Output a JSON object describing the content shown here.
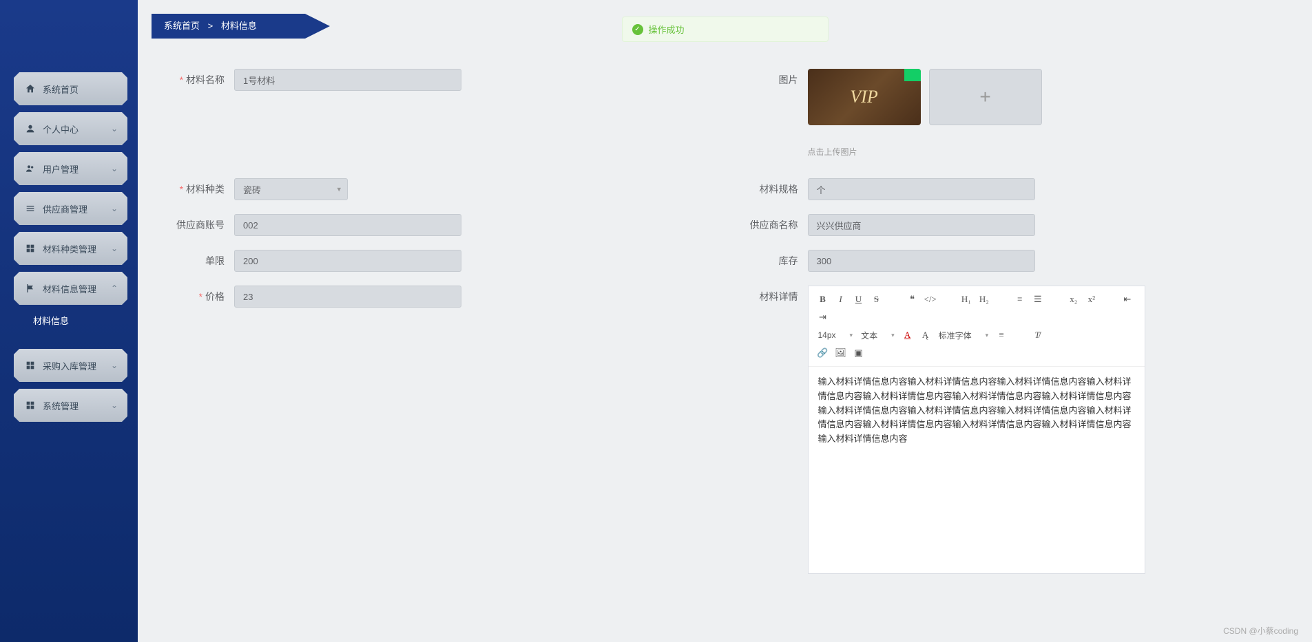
{
  "breadcrumb": {
    "home": "系统首页",
    "sep": ">",
    "current": "材料信息"
  },
  "alert": {
    "text": "操作成功"
  },
  "sidebar": {
    "items": [
      {
        "label": "系统首页",
        "icon": "home"
      },
      {
        "label": "个人中心",
        "icon": "user",
        "expandable": true
      },
      {
        "label": "用户管理",
        "icon": "users",
        "expandable": true
      },
      {
        "label": "供应商管理",
        "icon": "list",
        "expandable": true
      },
      {
        "label": "材料种类管理",
        "icon": "grid",
        "expandable": true
      },
      {
        "label": "材料信息管理",
        "icon": "flag",
        "expandable": true,
        "expanded": true
      },
      {
        "label": "材料信息",
        "active": true
      },
      {
        "label": "采购入库管理",
        "icon": "grid",
        "expandable": true
      },
      {
        "label": "系统管理",
        "icon": "grid",
        "expandable": true
      }
    ]
  },
  "form": {
    "material_name": {
      "label": "材料名称",
      "value": "1号材料"
    },
    "image": {
      "label": "图片",
      "hint": "点击上传图片",
      "thumb_text": "VIP"
    },
    "material_type": {
      "label": "材料种类",
      "value": "瓷砖"
    },
    "material_spec": {
      "label": "材料规格",
      "value": "个"
    },
    "supplier_account": {
      "label": "供应商账号",
      "value": "002"
    },
    "supplier_name": {
      "label": "供应商名称",
      "value": "兴兴供应商"
    },
    "unit_limit": {
      "label": "单限",
      "value": "200"
    },
    "stock": {
      "label": "库存",
      "value": "300"
    },
    "price": {
      "label": "价格",
      "value": "23"
    },
    "detail": {
      "label": "材料详情",
      "content": "输入材料详情信息内容输入材料详情信息内容输入材料详情信息内容输入材料详情信息内容输入材料详情信息内容输入材料详情信息内容输入材料详情信息内容输入材料详情信息内容输入材料详情信息内容输入材料详情信息内容输入材料详情信息内容输入材料详情信息内容输入材料详情信息内容输入材料详情信息内容输入材料详情信息内容"
    }
  },
  "editor": {
    "font_size": "14px",
    "font_family_label": "文本",
    "font_std_label": "标准字体"
  },
  "watermark": "CSDN @小蔡coding"
}
